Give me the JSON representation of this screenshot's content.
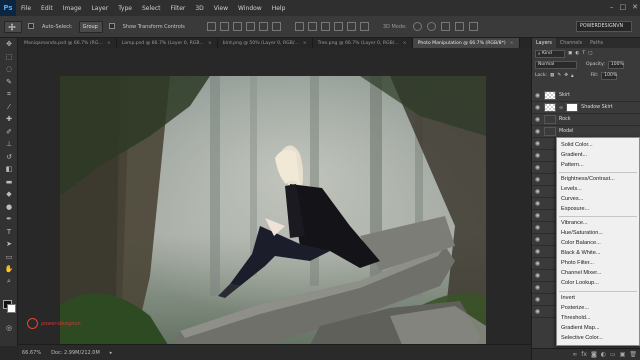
{
  "app": {
    "logo": "Ps",
    "window_controls": [
      "–",
      "□",
      "✕"
    ]
  },
  "menu": [
    "File",
    "Edit",
    "Image",
    "Layer",
    "Type",
    "Select",
    "Filter",
    "3D",
    "View",
    "Window",
    "Help"
  ],
  "options_bar": {
    "auto_select_label": "Auto-Select:",
    "group_value": "Group",
    "show_transform_label": "Show Transform Controls",
    "mode_3d_label": "3D Mode:",
    "workspace": "POWERDESIGNVN"
  },
  "doc_tabs": [
    {
      "label": "Maniqamanda.psd @ 66.7% (RG...",
      "active": false
    },
    {
      "label": "Lamp.psd @ 66.7% (Layer 0, RGB...",
      "active": false
    },
    {
      "label": "bird.png @ 50% (Layer 0, RGB/...",
      "active": false
    },
    {
      "label": "Tree.png @ 66.7% (Layer 0, RGB/...",
      "active": false
    },
    {
      "label": "Photo Manipulation @ 66.7% (RGB/8*)",
      "active": true
    }
  ],
  "watermark": {
    "text": "power-designvn"
  },
  "status": {
    "zoom": "66.67%",
    "doc": "Doc: 2.99M/212.0M"
  },
  "right_panel": {
    "tabs": [
      "Layers",
      "Channels",
      "Paths"
    ],
    "kind_label": "Kind",
    "blend_mode": "Normal",
    "opacity_label": "Opacity:",
    "opacity_value": "100%",
    "lock_label": "Lock:",
    "fill_label": "Fill:",
    "fill_value": "100%",
    "layers": [
      {
        "name": "Skirt",
        "mask": false
      },
      {
        "name": "Shadow Skirt",
        "mask": true
      },
      {
        "name": "Rock",
        "mask": false
      },
      {
        "name": "Model",
        "mask": false
      }
    ]
  },
  "adjust_menu": {
    "groups": [
      [
        "Solid Color...",
        "Gradient...",
        "Pattern..."
      ],
      [
        "Brightness/Contrast...",
        "Levels...",
        "Curves...",
        "Exposure..."
      ],
      [
        "Vibrance...",
        "Hue/Saturation...",
        "Color Balance...",
        "Black & White...",
        "Photo Filter...",
        "Channel Mixer...",
        "Color Lookup..."
      ],
      [
        "Invert",
        "Posterize...",
        "Threshold...",
        "Gradient Map...",
        "Selective Color..."
      ]
    ]
  }
}
